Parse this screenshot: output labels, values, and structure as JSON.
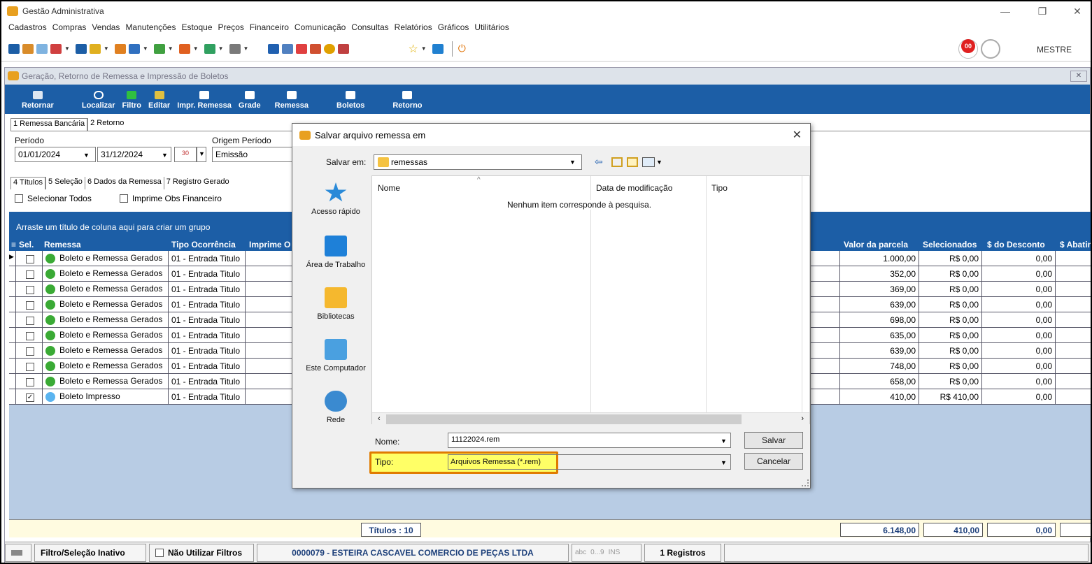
{
  "app": {
    "title": "Gestão Administrativa",
    "user": "MESTRE",
    "notif_badge": "00"
  },
  "menu": [
    "Cadastros",
    "Compras",
    "Vendas",
    "Manutenções",
    "Estoque",
    "Preços",
    "Financeiro",
    "Comunicação",
    "Consultas",
    "Relatórios",
    "Gráficos",
    "Utilitários"
  ],
  "window": {
    "title": "Geração, Retorno de Remessa e Impressão de Boletos"
  },
  "ribbon": [
    "Retornar",
    "Localizar",
    "Filtro",
    "Editar",
    "Impr. Remessa",
    "Grade",
    "Remessa",
    "Boletos",
    "Retorno"
  ],
  "tabs_top": [
    "1 Remessa Bancária",
    "2 Retorno"
  ],
  "filters": {
    "periodo_label": "Período",
    "date_from": "01/01/2024",
    "date_to": "31/12/2024",
    "calendar_value": "30",
    "origem_label": "Origem Período",
    "origem_value": "Emissão"
  },
  "tabs_bottom": [
    "4 Títulos",
    "5 Seleção",
    "6 Dados da Remessa",
    "7 Registro Gerado"
  ],
  "checks": {
    "select_all": "Selecionar Todos",
    "imprime_obs": "Imprime Obs Financeiro"
  },
  "group_hint": "Arraste um título de coluna aqui para criar um grupo",
  "columns": {
    "sel": "Sel.",
    "remessa": "Remessa",
    "tipo": "Tipo Ocorrência",
    "imprime": "Imprime O",
    "valor": "Valor da parcela",
    "selecionados": "Selecionados",
    "desconto": "$ do Desconto",
    "abatim": "$ Abatim"
  },
  "rows": [
    {
      "checked": false,
      "remessa": "Boleto e Remessa Gerados",
      "tipo": "01 - Entrada Titulo",
      "valor": "1.000,00",
      "sel": "R$ 0,00",
      "desc": "0,00",
      "status_color": "#3aaa35",
      "current": true
    },
    {
      "checked": false,
      "remessa": "Boleto e Remessa Gerados",
      "tipo": "01 - Entrada Titulo",
      "valor": "352,00",
      "sel": "R$ 0,00",
      "desc": "0,00",
      "status_color": "#3aaa35"
    },
    {
      "checked": false,
      "remessa": "Boleto e Remessa Gerados",
      "tipo": "01 - Entrada Titulo",
      "valor": "369,00",
      "sel": "R$ 0,00",
      "desc": "0,00",
      "status_color": "#3aaa35"
    },
    {
      "checked": false,
      "remessa": "Boleto e Remessa Gerados",
      "tipo": "01 - Entrada Titulo",
      "valor": "639,00",
      "sel": "R$ 0,00",
      "desc": "0,00",
      "status_color": "#3aaa35"
    },
    {
      "checked": false,
      "remessa": "Boleto e Remessa Gerados",
      "tipo": "01 - Entrada Titulo",
      "valor": "698,00",
      "sel": "R$ 0,00",
      "desc": "0,00",
      "status_color": "#3aaa35"
    },
    {
      "checked": false,
      "remessa": "Boleto e Remessa Gerados",
      "tipo": "01 - Entrada Titulo",
      "valor": "635,00",
      "sel": "R$ 0,00",
      "desc": "0,00",
      "status_color": "#3aaa35"
    },
    {
      "checked": false,
      "remessa": "Boleto e Remessa Gerados",
      "tipo": "01 - Entrada Titulo",
      "valor": "639,00",
      "sel": "R$ 0,00",
      "desc": "0,00",
      "status_color": "#3aaa35"
    },
    {
      "checked": false,
      "remessa": "Boleto e Remessa Gerados",
      "tipo": "01 - Entrada Titulo",
      "valor": "748,00",
      "sel": "R$ 0,00",
      "desc": "0,00",
      "status_color": "#3aaa35"
    },
    {
      "checked": false,
      "remessa": "Boleto e Remessa Gerados",
      "tipo": "01 - Entrada Titulo",
      "valor": "658,00",
      "sel": "R$ 0,00",
      "desc": "0,00",
      "status_color": "#3aaa35"
    },
    {
      "checked": true,
      "remessa": "Boleto Impresso",
      "tipo": "01 - Entrada Titulo",
      "valor": "410,00",
      "sel": "R$ 410,00",
      "desc": "0,00",
      "status_color": "#5ab4f0"
    }
  ],
  "footer": {
    "titulos": "Títulos : 10",
    "total_valor": "6.148,00",
    "total_sel": "410,00",
    "total_desc": "0,00"
  },
  "status": {
    "filtro": "Filtro/Seleção Inativo",
    "nao_utilizar": "Não Utilizar Filtros",
    "empresa": "0000079 - ESTEIRA CASCAVEL COMERCIO DE PEÇAS LTDA",
    "abc": "abc",
    "nums": "0...9",
    "ins": "INS",
    "registros": "1 Registros"
  },
  "dialog": {
    "title": "Salvar arquivo remessa em",
    "salvar_em_label": "Salvar em:",
    "folder": "remessas",
    "places": [
      "Acesso rápido",
      "Área de Trabalho",
      "Bibliotecas",
      "Este Computador",
      "Rede"
    ],
    "col_nome": "Nome",
    "col_data": "Data de modificação",
    "col_tipo": "Tipo",
    "empty_msg": "Nenhum item corresponde à pesquisa.",
    "nome_label": "Nome:",
    "nome_value": "11122024.rem",
    "tipo_label": "Tipo:",
    "tipo_value": "Arquivos Remessa (*.rem)",
    "salvar": "Salvar",
    "cancelar": "Cancelar"
  },
  "colors": {
    "brand_blue": "#1c5ea6",
    "highlight": "#ffff66",
    "highlight_border": "#e07b00"
  }
}
